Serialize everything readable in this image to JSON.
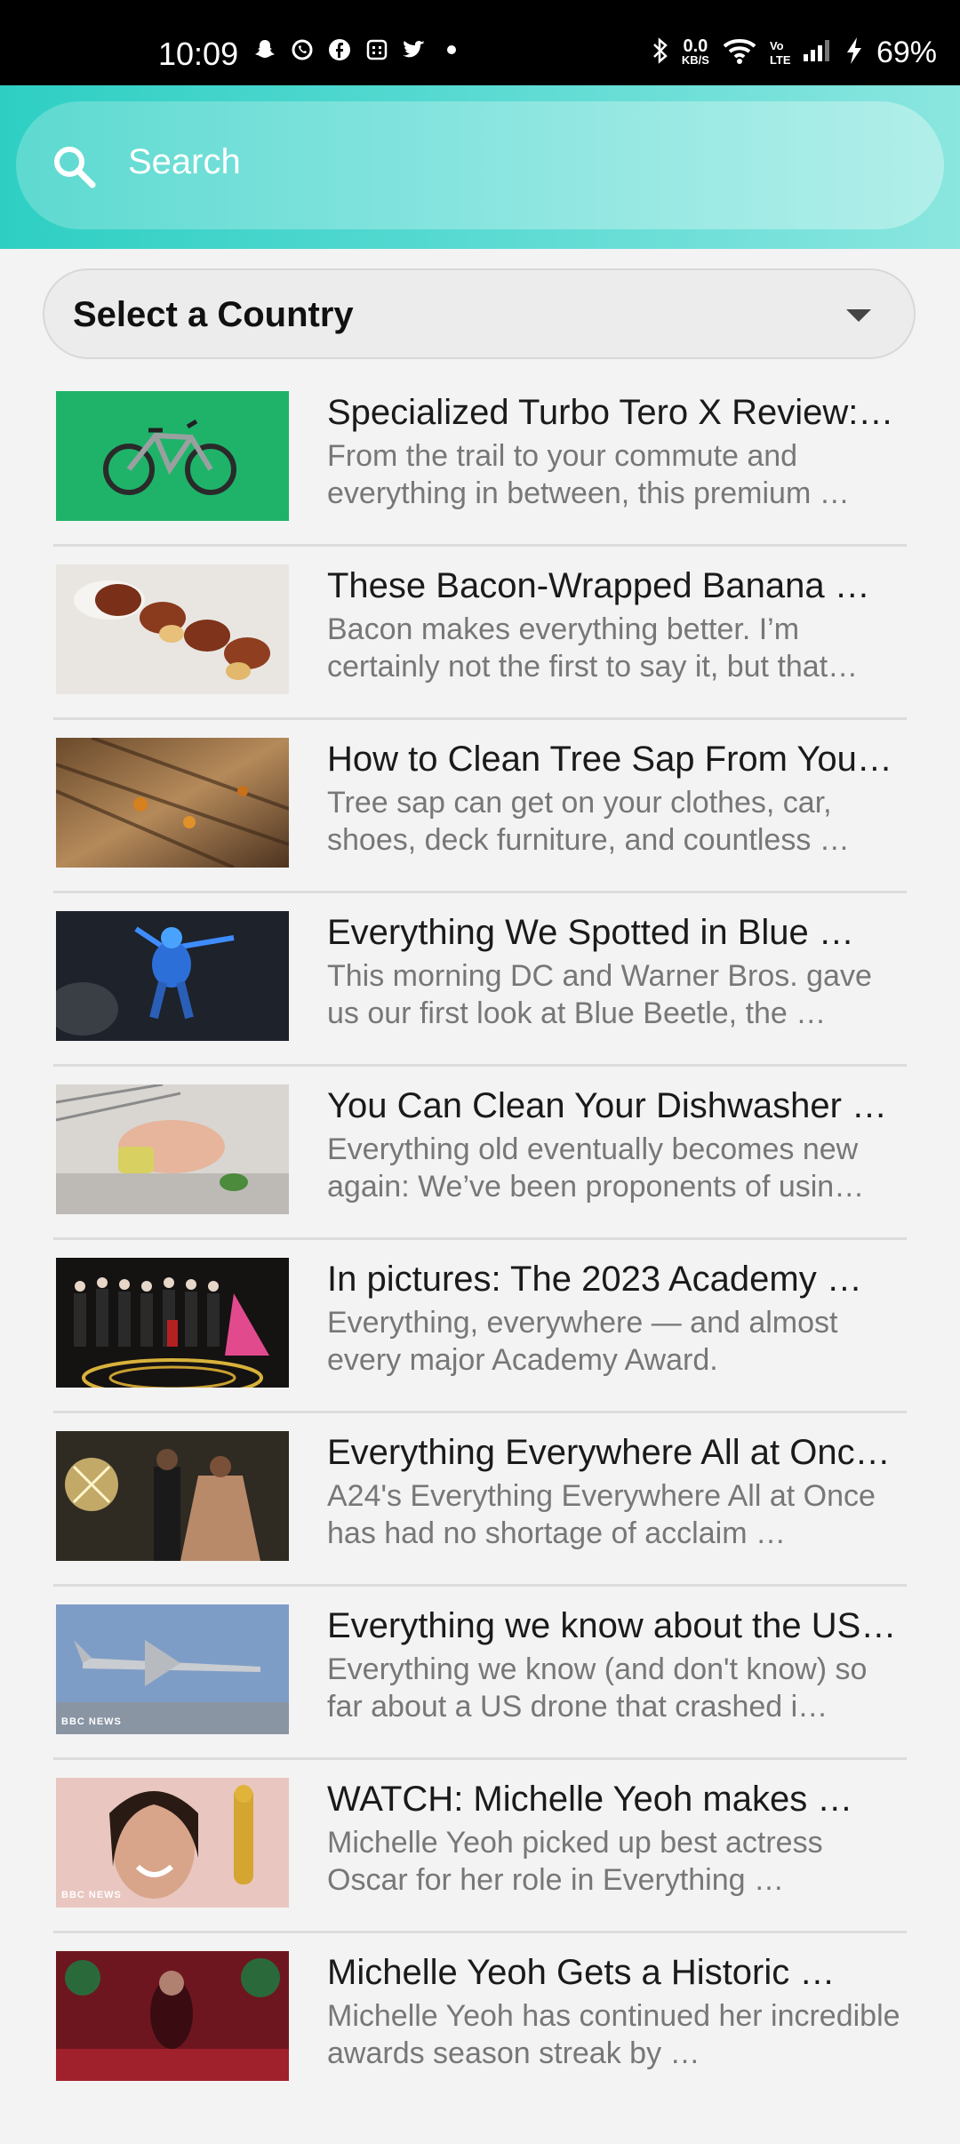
{
  "status_bar": {
    "time": "10:09",
    "data_rate_top": "0.0",
    "data_rate_unit": "KB/S",
    "volte": "Vo LTE",
    "battery": "69%",
    "icons_left": [
      "snapchat-icon",
      "whatsapp-icon",
      "facebook-icon",
      "calendar-icon",
      "twitter-icon",
      "dot-icon"
    ],
    "icons_right": [
      "bluetooth-icon",
      "wifi-icon",
      "signal-icon",
      "charging-icon"
    ]
  },
  "search": {
    "placeholder": "Search"
  },
  "country_select": {
    "label": "Select a Country"
  },
  "colors": {
    "header_start": "#2ecfc3",
    "header_end": "#8ae6df",
    "title": "#1a1a1a",
    "desc": "#777777"
  },
  "articles": [
    {
      "title": "Specialized Turbo Tero X Review:…",
      "desc": "From the trail to your commute and everything in between, this premium …",
      "thumb": "bike"
    },
    {
      "title": "These Bacon-Wrapped Banana …",
      "desc": "Bacon makes everything better. I’m certainly not the first to say it, but that…",
      "thumb": "bacon"
    },
    {
      "title": "How to Clean Tree Sap From You…",
      "desc": "Tree sap can get on your clothes, car, shoes, deck furniture, and countless …",
      "thumb": "sap"
    },
    {
      "title": "Everything We Spotted in Blue …",
      "desc": "This morning DC and Warner Bros. gave us our first look at Blue Beetle, the …",
      "thumb": "beetle"
    },
    {
      "title": "You Can Clean Your Dishwasher …",
      "desc": "Everything old eventually becomes new again: We’ve been proponents of usin…",
      "thumb": "dishwasher"
    },
    {
      "title": "In pictures: The 2023 Academy …",
      "desc": "Everything, everywhere — and almost every major Academy Award.",
      "thumb": "academy"
    },
    {
      "title": "Everything Everywhere All at Onc…",
      "desc": "A24's Everything Everywhere All at Once has had no shortage of acclaim …",
      "thumb": "ballroom"
    },
    {
      "title": "Everything we know about the US…",
      "desc": "Everything we know (and don't know) so far about a US drone that crashed i…",
      "thumb": "drone",
      "badge": "BBC NEWS"
    },
    {
      "title": "WATCH: Michelle Yeoh makes …",
      "desc": "Michelle Yeoh picked up best actress Oscar for her role in Everything …",
      "thumb": "yeoh",
      "badge": "BBC NEWS"
    },
    {
      "title": "Michelle Yeoh Gets a Historic …",
      "desc": "Michelle Yeoh has continued her incredible awards season streak by …",
      "thumb": "yeoh2"
    }
  ]
}
